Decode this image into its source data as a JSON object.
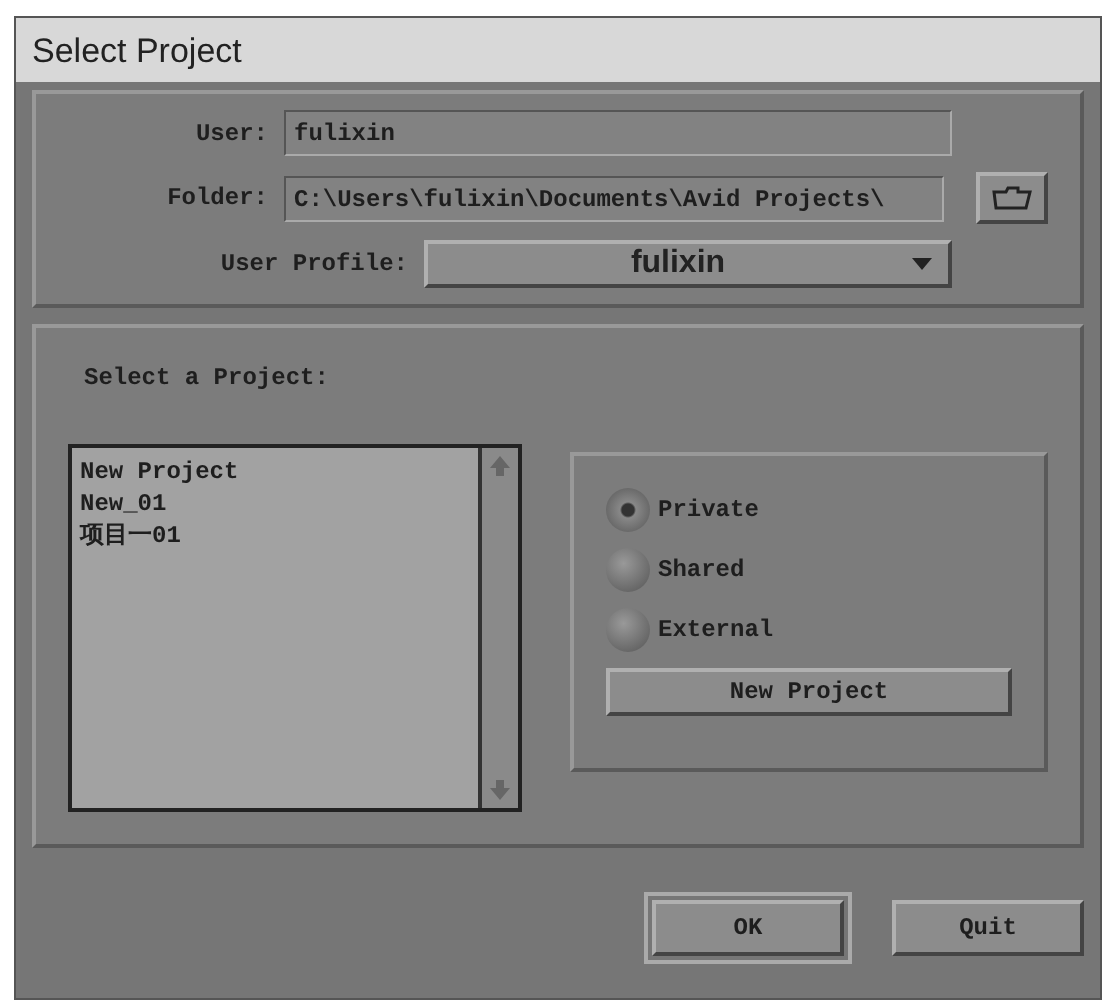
{
  "window": {
    "title": "Select Project"
  },
  "user": {
    "label": "User:",
    "value": "fulixin"
  },
  "folder": {
    "label": "Folder:",
    "value": "C:\\Users\\fulixin\\Documents\\Avid Projects\\"
  },
  "user_profile": {
    "label": "User Profile:",
    "value": "fulixin"
  },
  "project_list": {
    "label": "Select a Project:",
    "items": [
      {
        "text": "New Project"
      },
      {
        "text": "New_01"
      },
      {
        "text": "项目一01"
      }
    ]
  },
  "project_type": [
    {
      "label": "Private",
      "selected": true
    },
    {
      "label": "Shared",
      "selected": false
    },
    {
      "label": "External",
      "selected": false
    }
  ],
  "new_project_button": "New Project",
  "buttons": [
    {
      "label": "OK",
      "kind": "default"
    },
    {
      "label": "Quit",
      "kind": "normal"
    }
  ]
}
